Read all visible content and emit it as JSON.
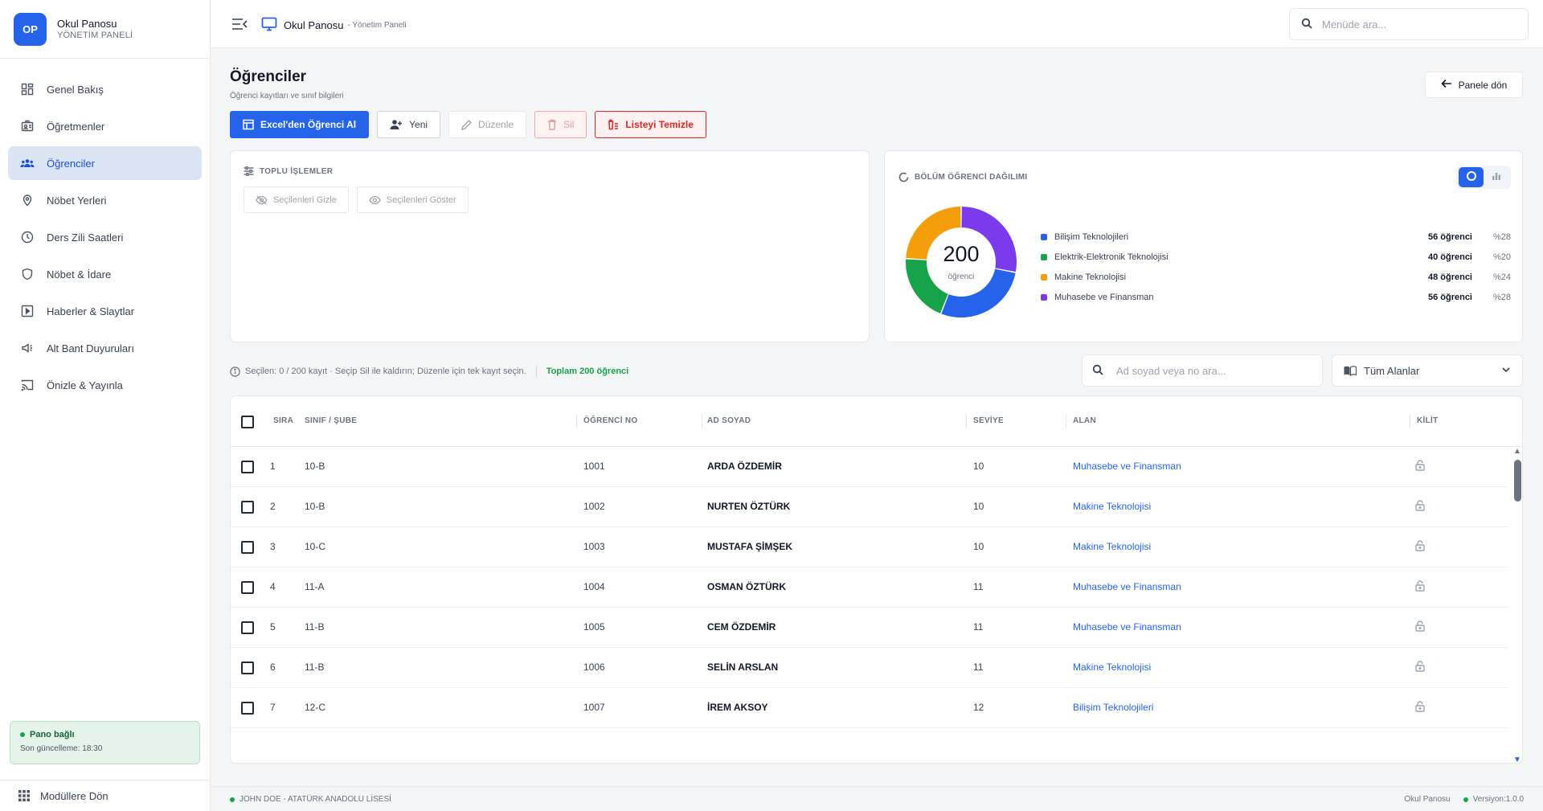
{
  "brand": {
    "logo": "OP",
    "title": "Okul Panosu",
    "subtitle": "YÖNETİM PANELİ"
  },
  "sidebar": {
    "items": [
      {
        "label": "Genel Bakış",
        "icon": "dashboard-icon",
        "active": false
      },
      {
        "label": "Öğretmenler",
        "icon": "teacher-icon",
        "active": false
      },
      {
        "label": "Öğrenciler",
        "icon": "students-icon",
        "active": true
      },
      {
        "label": "Nöbet Yerleri",
        "icon": "location-pin-icon",
        "active": false
      },
      {
        "label": "Ders Zili Saatleri",
        "icon": "clock-icon",
        "active": false
      },
      {
        "label": "Nöbet & İdare",
        "icon": "shield-icon",
        "active": false
      },
      {
        "label": "Haberler & Slaytlar",
        "icon": "play-slides-icon",
        "active": false
      },
      {
        "label": "Alt Bant Duyuruları",
        "icon": "megaphone-icon",
        "active": false
      },
      {
        "label": "Önizle & Yayınla",
        "icon": "cast-icon",
        "active": false
      }
    ],
    "status_title": "Pano bağlı",
    "status_sub": "Son güncelleme: 18:30",
    "bottom_label": "Modüllere Dön"
  },
  "topbar": {
    "app_name": "Okul Panosu",
    "app_sub": "- Yönetim Paneli",
    "search_placeholder": "Menüde ara..."
  },
  "page": {
    "title": "Öğrenciler",
    "subtitle": "Öğrenci kayıtları ve sınıf bilgileri",
    "back_label": "Panele dön"
  },
  "actions": {
    "import_label": "Excel'den Öğrenci Al",
    "new_label": "Yeni",
    "edit_label": "Düzenle",
    "delete_label": "Sil",
    "clear_label": "Listeyi Temizle"
  },
  "bulk": {
    "label": "TOPLU İŞLEMLER",
    "hide_label": "Seçilenleri Gizle",
    "show_label": "Seçilenleri Göster"
  },
  "distribution": {
    "label": "BÖLÜM ÖĞRENCİ DAĞILIMI",
    "total": "200",
    "total_unit": "öğrenci",
    "slices": [
      {
        "name": "Bilişim Teknolojileri",
        "count_label": "56 öğrenci",
        "pct_label": "%28",
        "value": 56,
        "color": "#2563eb"
      },
      {
        "name": "Elektrik-Elektronik Teknolojisi",
        "count_label": "40 öğrenci",
        "pct_label": "%20",
        "value": 40,
        "color": "#16a34a"
      },
      {
        "name": "Makine Teknolojisi",
        "count_label": "48 öğrenci",
        "pct_label": "%24",
        "value": 48,
        "color": "#f59e0b"
      },
      {
        "name": "Muhasebe ve Finansman",
        "count_label": "56 öğrenci",
        "pct_label": "%28",
        "value": 56,
        "color": "#7c3aed"
      }
    ]
  },
  "filters": {
    "selection_info": "Seçilen: 0 / 200 kayıt · Seçip Sil ile kaldırın; Düzenle için tek kayıt seçin.",
    "total_label": "Toplam 200 öğrenci",
    "name_search_placeholder": "Ad soyad veya no ara...",
    "area_select_value": "Tüm Alanlar"
  },
  "table": {
    "headers": {
      "sira": "SIRA",
      "sinif": "SINIF / ŞUBE",
      "no": "ÖĞRENCİ NO",
      "name": "AD SOYAD",
      "level": "SEVİYE",
      "area": "ALAN",
      "lock": "KİLİT"
    },
    "rows": [
      {
        "sira": "1",
        "sinif": "10-B",
        "no": "1001",
        "name": "ARDA ÖZDEMİR",
        "level": "10",
        "area": "Muhasebe ve Finansman"
      },
      {
        "sira": "2",
        "sinif": "10-B",
        "no": "1002",
        "name": "NURTEN ÖZTÜRK",
        "level": "10",
        "area": "Makine Teknolojisi"
      },
      {
        "sira": "3",
        "sinif": "10-C",
        "no": "1003",
        "name": "MUSTAFA ŞİMŞEK",
        "level": "10",
        "area": "Makine Teknolojisi"
      },
      {
        "sira": "4",
        "sinif": "11-A",
        "no": "1004",
        "name": "OSMAN ÖZTÜRK",
        "level": "11",
        "area": "Muhasebe ve Finansman"
      },
      {
        "sira": "5",
        "sinif": "11-B",
        "no": "1005",
        "name": "CEM ÖZDEMİR",
        "level": "11",
        "area": "Muhasebe ve Finansman"
      },
      {
        "sira": "6",
        "sinif": "11-B",
        "no": "1006",
        "name": "SELİN ARSLAN",
        "level": "11",
        "area": "Makine Teknolojisi"
      },
      {
        "sira": "7",
        "sinif": "12-C",
        "no": "1007",
        "name": "İREM AKSOY",
        "level": "12",
        "area": "Bilişim Teknolojileri"
      }
    ]
  },
  "footer": {
    "user": "JOHN DOE - ATATÜRK ANADOLU LİSESİ",
    "app": "Okul Panosu",
    "version": "Versiyon:1.0.0"
  }
}
